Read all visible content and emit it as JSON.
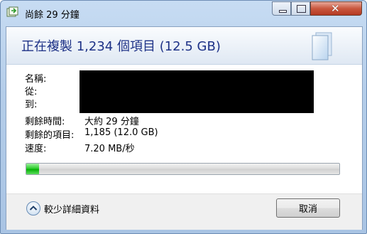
{
  "window": {
    "title": "尚餘 29 分鐘",
    "controls": {
      "minimize": "minimize",
      "maximize": "maximize",
      "close": "✕"
    }
  },
  "header": {
    "heading": "正在複製 1,234 個項目 (12.5 GB)"
  },
  "details": {
    "name_label": "名稱:",
    "from_label": "從:",
    "to_label": "到:",
    "time_remaining_label": "剩餘時間:",
    "time_remaining_value": "大約 29 分鐘",
    "items_remaining_label": "剩餘的項目:",
    "items_remaining_value": "1,185 (12.0 GB)",
    "speed_label": "速度:",
    "speed_value": "7.20 MB/秒"
  },
  "progress": {
    "percent": 4
  },
  "footer": {
    "less_details_label": "較少詳細資料",
    "cancel_label": "取消"
  },
  "colors": {
    "heading": "#1e3287",
    "progress_fill": "#06b006",
    "title_bar": "#b4cde9"
  },
  "icons": {
    "app": "copy-files-icon",
    "header": "document-icon",
    "details_toggle": "chevron-up-icon"
  }
}
